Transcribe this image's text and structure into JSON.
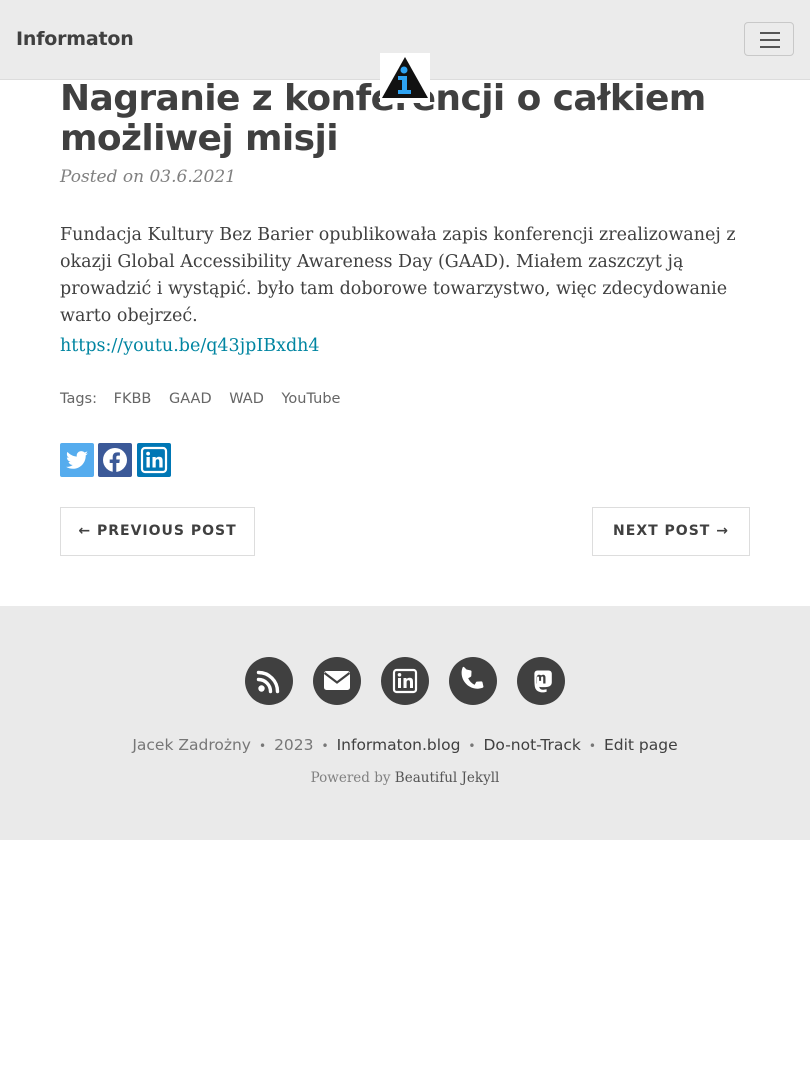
{
  "navbar": {
    "brand": "Informaton",
    "toggle_label": "Toggle navigation",
    "avatar_icon": "informaton-logo-icon"
  },
  "post": {
    "title": "Nagranie z konferencji o całkiem możliwej misji",
    "meta": "Posted on 03.6.2021",
    "body": "Fundacja Kultury Bez Barier opublikowała zapis konferencji zrealizowanej z okazji Global Accessibility Awareness Day (GAAD). Miałem zaszczyt ją prowadzić i wystąpić. było tam doborowe towarzystwo, więc zdecydowanie warto obejrzeć.",
    "link": "https://youtu.be/q43jpIBxdh4"
  },
  "tags": {
    "label": "Tags:",
    "items": [
      "FKBB",
      "GAAD",
      "WAD",
      "YouTube"
    ]
  },
  "share": {
    "icons": [
      "twitter-icon",
      "facebook-icon",
      "linkedin-icon"
    ],
    "colors": {
      "twitter": "#55acee",
      "facebook": "#3b5998",
      "linkedin": "#0077b5"
    }
  },
  "pager": {
    "previous": "← PREVIOUS POST",
    "next": "NEXT POST →"
  },
  "footer": {
    "social_icons": [
      "rss-icon",
      "email-icon",
      "linkedin-icon",
      "phone-icon",
      "mastodon-icon"
    ],
    "author": "Jacek Zadrożny",
    "year": "2023",
    "site": "Informaton.blog",
    "dnt": "Do-not-Track",
    "edit": "Edit page",
    "separator": "•",
    "powered_prefix": "Powered by",
    "powered_link": "Beautiful Jekyll"
  }
}
